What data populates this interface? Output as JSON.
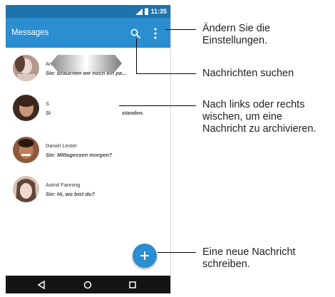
{
  "status_bar": {
    "time": "11:35"
  },
  "app_bar": {
    "title": "Messages",
    "search_icon": "search-icon",
    "overflow_icon": "more-vert-icon"
  },
  "conversations": [
    {
      "name": "Anne",
      "preview": "Sie: Brauchen wir noch ein pa..."
    },
    {
      "name": "S",
      "preview": "Si...standen."
    },
    {
      "name": "Daniel Lester",
      "preview": "Sie: Mittagessen morgen?"
    },
    {
      "name": "Astrid Fanning",
      "preview": "Sie: Hi, wo bist du?"
    }
  ],
  "swipe": {
    "left_fragment": "S",
    "left_fragment_2": "Si",
    "right_fragment": "standen."
  },
  "fab": {
    "icon": "plus-icon"
  },
  "nav_bar": {
    "back_icon": "back-triangle-icon",
    "home_icon": "home-circle-icon",
    "recents_icon": "recents-square-icon"
  },
  "callouts": {
    "settings_line1": "Ändern Sie die",
    "settings_line2": "Einstellungen.",
    "search": "Nachrichten suchen",
    "swipe_line1": "Nach links oder rechts",
    "swipe_line2": "wischen, um eine",
    "swipe_line3": "Nachricht zu archivieren.",
    "new_line1": "Eine neue Nachricht",
    "new_line2": "schreiben."
  },
  "colors": {
    "status_bar": "#1e73ad",
    "app_bar": "#2a8ed0",
    "fab": "#2a8ed0",
    "nav_bar": "#141414"
  }
}
